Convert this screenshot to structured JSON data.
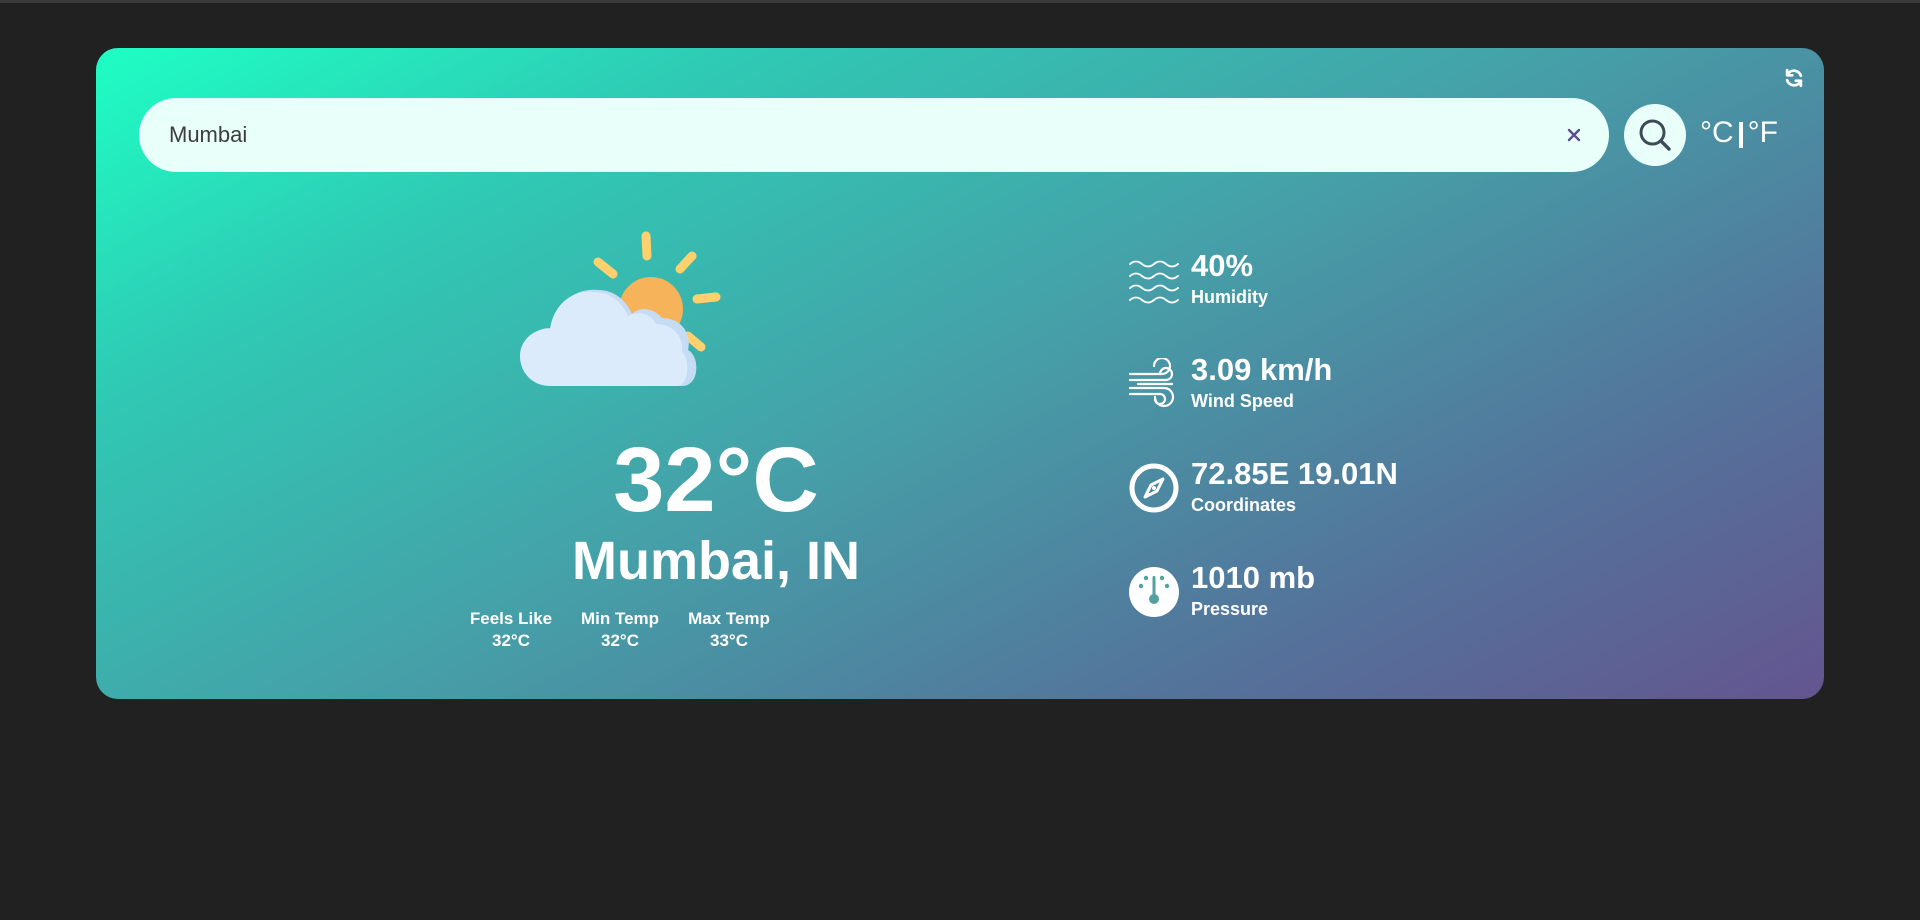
{
  "search": {
    "value": "Mumbai",
    "placeholder": ""
  },
  "units": {
    "celsius": "°C",
    "fahrenheit": "°F"
  },
  "current": {
    "temperature": "32°C",
    "location": "Mumbai, IN",
    "condition_icon": "partly-cloudy-icon"
  },
  "details": [
    {
      "label": "Feels Like",
      "value": "32°C"
    },
    {
      "label": "Min Temp",
      "value": "32°C"
    },
    {
      "label": "Max Temp",
      "value": "33°C"
    }
  ],
  "stats": [
    {
      "value": "40%",
      "label": "Humidity",
      "icon": "humidity-waves-icon"
    },
    {
      "value": "3.09 km/h",
      "label": "Wind Speed",
      "icon": "wind-icon"
    },
    {
      "value": "72.85E 19.01N",
      "label": "Coordinates",
      "icon": "compass-icon"
    },
    {
      "value": "1010 mb",
      "label": "Pressure",
      "icon": "pressure-gauge-icon"
    }
  ],
  "colors": {
    "background": "#212121",
    "gradient_start": "#1effc4",
    "gradient_end": "#645590",
    "search_bg": "#e9fffa",
    "text": "#ffffff"
  }
}
